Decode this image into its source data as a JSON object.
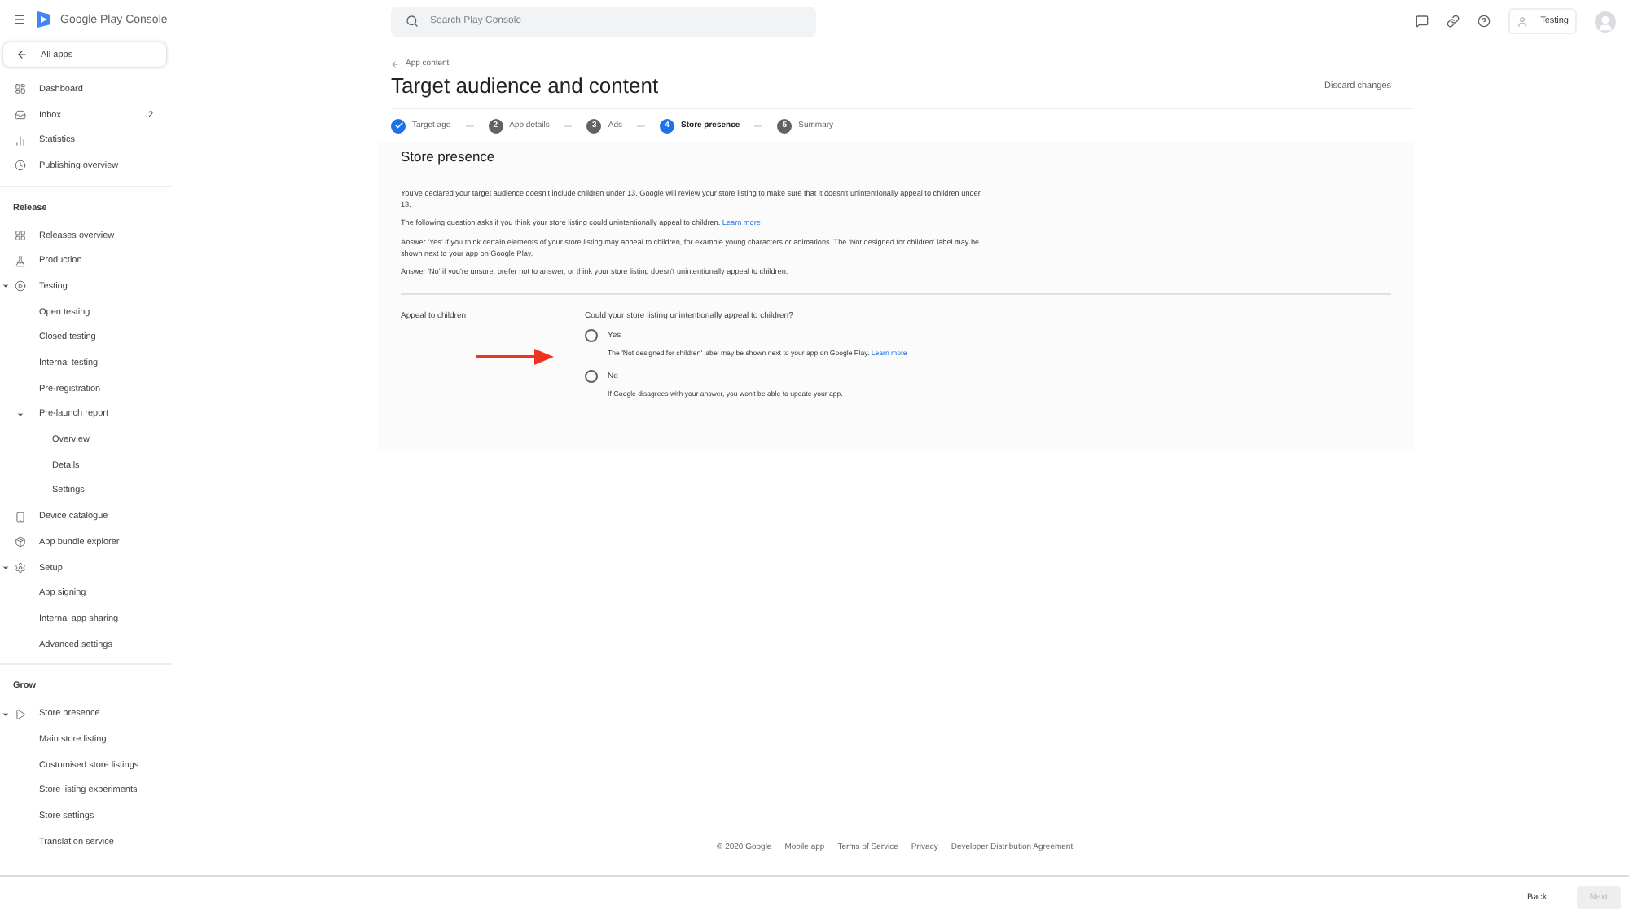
{
  "app": {
    "name": "Google Play Console"
  },
  "sidebar": {
    "back": "All apps",
    "sections": [
      {
        "items": [
          {
            "label": "Dashboard"
          },
          {
            "label": "Inbox",
            "badge": "2"
          },
          {
            "label": "Statistics"
          },
          {
            "label": "Publishing overview"
          }
        ]
      },
      {
        "heading": "Release",
        "items": [
          {
            "label": "Releases overview"
          },
          {
            "label": "Production"
          },
          {
            "label": "Testing",
            "expanded": true,
            "children": [
              {
                "label": "Open testing"
              },
              {
                "label": "Closed testing"
              },
              {
                "label": "Internal testing"
              },
              {
                "label": "Pre-registration"
              },
              {
                "label": "Pre-launch report",
                "expanded": true,
                "children": [
                  {
                    "label": "Overview"
                  },
                  {
                    "label": "Details"
                  },
                  {
                    "label": "Settings"
                  }
                ]
              }
            ]
          },
          {
            "label": "Device catalogue"
          },
          {
            "label": "App bundle explorer"
          },
          {
            "label": "Setup",
            "expanded": true,
            "children": [
              {
                "label": "App signing"
              },
              {
                "label": "Internal app sharing"
              },
              {
                "label": "Advanced settings"
              }
            ]
          }
        ]
      },
      {
        "heading": "Grow",
        "items": [
          {
            "label": "Store presence",
            "expanded": true,
            "children": [
              {
                "label": "Main store listing"
              },
              {
                "label": "Customised store listings"
              },
              {
                "label": "Store listing experiments"
              },
              {
                "label": "Store settings"
              },
              {
                "label": "Translation service"
              }
            ]
          }
        ]
      }
    ]
  },
  "search": {
    "placeholder": "Search Play Console"
  },
  "account": {
    "name": "Testing"
  },
  "breadcrumb": "App content",
  "title": "Target audience and content",
  "discard": "Discard changes",
  "steps": [
    {
      "label": "Target age",
      "done": true,
      "selected": false
    },
    {
      "number": "2",
      "label": "App details",
      "done": false,
      "selected": false
    },
    {
      "number": "3",
      "label": "Ads",
      "done": false,
      "selected": false
    },
    {
      "number": "4",
      "label": "Store presence",
      "done": false,
      "selected": true
    },
    {
      "number": "5",
      "label": "Summary",
      "done": false,
      "selected": false
    }
  ],
  "section": {
    "title": "Store presence",
    "paragraphs": [
      {
        "text": "You've declared your target audience doesn't include children under 13. Google will review your store listing to make sure that it doesn't unintentionally appeal to children under 13."
      },
      {
        "text": "The following question asks if you think your store listing could unintentionally appeal to children.",
        "link": "Learn more"
      },
      {
        "text": "Answer 'Yes' if you think certain elements of your store listing may appeal to children, for example young characters or animations. The 'Not designed for children' label may be shown next to your app on Google Play."
      },
      {
        "text": "Answer 'No' if you're unsure, prefer not to answer, or think your store listing doesn't unintentionally appeal to children."
      }
    ],
    "field_label": "Appeal to children",
    "question": "Could your store listing unintentionally appeal to children?",
    "options": [
      {
        "label": "Yes",
        "selected": false,
        "help": "The 'Not designed for children' label may be shown next to your app on Google Play.",
        "link": "Learn more"
      },
      {
        "label": "No",
        "selected": false,
        "help": "If Google disagrees with your answer, you won't be able to update your app."
      }
    ]
  },
  "footer": [
    "© 2020 Google",
    "Mobile app",
    "Terms of Service",
    "Privacy",
    "Developer Distribution Agreement"
  ],
  "actions": [
    {
      "label": "Back",
      "disabled": false
    },
    {
      "label": "Next",
      "disabled": true
    }
  ]
}
